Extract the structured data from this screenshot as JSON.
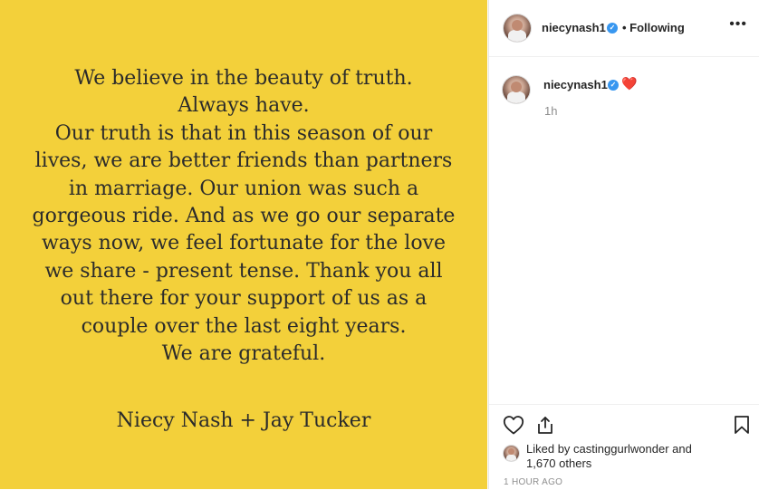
{
  "post": {
    "lines": [
      "We believe in the beauty of truth.",
      "Always have.",
      "Our truth is that in this season of our",
      "lives, we are better friends than partners",
      "in marriage. Our union was such a",
      "gorgeous ride. And as we go our separate",
      "ways now, we feel fortunate for the love",
      "we share - present tense. Thank you all",
      "out there for your support of us as a",
      "couple over the last eight years.",
      "We are grateful."
    ],
    "signature": "Niecy Nash + Jay Tucker",
    "background_color": "#f3d03a"
  },
  "header": {
    "username": "niecynash1",
    "verified_mark": "✓",
    "follow_status": "• Following",
    "more_icon": "•••"
  },
  "comment": {
    "username": "niecynash1",
    "verified_mark": "✓",
    "emoji": "❤️",
    "time": "1h"
  },
  "actions": {
    "liked_prefix": "Liked by ",
    "liked_user": "castinggurlwonder",
    "liked_and": " and",
    "liked_others": "1,670 others",
    "time_ago": "1 HOUR AGO"
  },
  "icons": [
    "heart-outline-icon",
    "share-icon",
    "bookmark-icon",
    "more-icon",
    "verified-badge-icon"
  ],
  "colors": {
    "accent_blue": "#3897f0",
    "muted_text": "#8e8e8e",
    "heart": "#e0245e"
  }
}
